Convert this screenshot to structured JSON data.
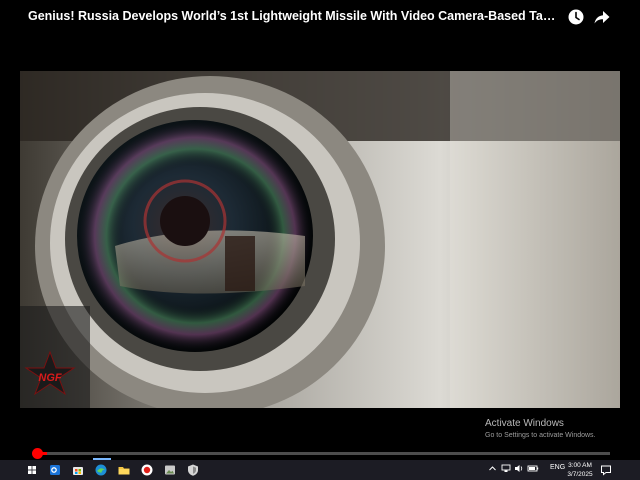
{
  "video": {
    "title": "Genius! Russia Develops World’s 1st Lightweight Missile With Video Camera-Based Targeting ...",
    "watermark_text": "NGF",
    "progress_fraction": 0.02
  },
  "icons": {
    "watch_later": "clock-icon",
    "share": "share-arrow-icon"
  },
  "activation": {
    "title": "Activate Windows",
    "subtitle": "Go to Settings to activate Windows."
  },
  "taskbar": {
    "apps": [
      "windows-start-icon",
      "outlook-icon",
      "store-icon",
      "edge-icon",
      "file-explorer-icon",
      "screen-recorder-icon",
      "image-viewer-icon",
      "shield-app-icon"
    ],
    "tray": {
      "language": "ENG",
      "time": "3:00 AM",
      "date": "3/7/2025"
    }
  },
  "colors": {
    "progress": "#ff0000",
    "taskbar": "#1c1c24",
    "accent": "#7ab8ff"
  }
}
